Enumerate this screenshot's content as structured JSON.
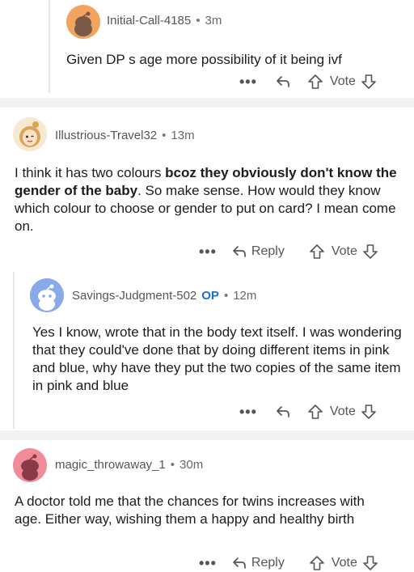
{
  "comments": [
    {
      "username": "Initial-Call-4185",
      "time": "3m",
      "text": "Given DP s age more possibility of it being ivf",
      "vote_label": "Vote"
    },
    {
      "username": "Illustrious-Travel32",
      "time": "13m",
      "text_before_bold": "I think it has two colours ",
      "text_bold": "bcoz they obviously don't know the gender of the baby",
      "text_after_bold": ". So make sense. How would they know which colour to choose or gender to put on card? I mean come on.",
      "reply_label": "Reply",
      "vote_label": "Vote"
    },
    {
      "username": "Savings-Judgment-502",
      "op_badge": "OP",
      "time": "12m",
      "text": "Yes I know, wrote that in the body text itself. I was wondering that they could've done that by doing different items in pink and blue, why have they put the two copies of the same item in pink and blue",
      "vote_label": "Vote"
    },
    {
      "username": "magic_throwaway_1",
      "time": "30m",
      "text": "A doctor told me that the chances for twins increases with age. Either way, wishing them a happy and healthy birth",
      "reply_label": "Reply",
      "vote_label": "Vote"
    }
  ],
  "separator_dot": "•",
  "more_label": "•••",
  "colors": {
    "avatar_orange": "#f2a35e",
    "avatar_blue": "#8aa9e8",
    "avatar_pink": "#f08c9a",
    "avatar_cream": "#f7e9cf",
    "op_blue": "#1a6fd0"
  }
}
